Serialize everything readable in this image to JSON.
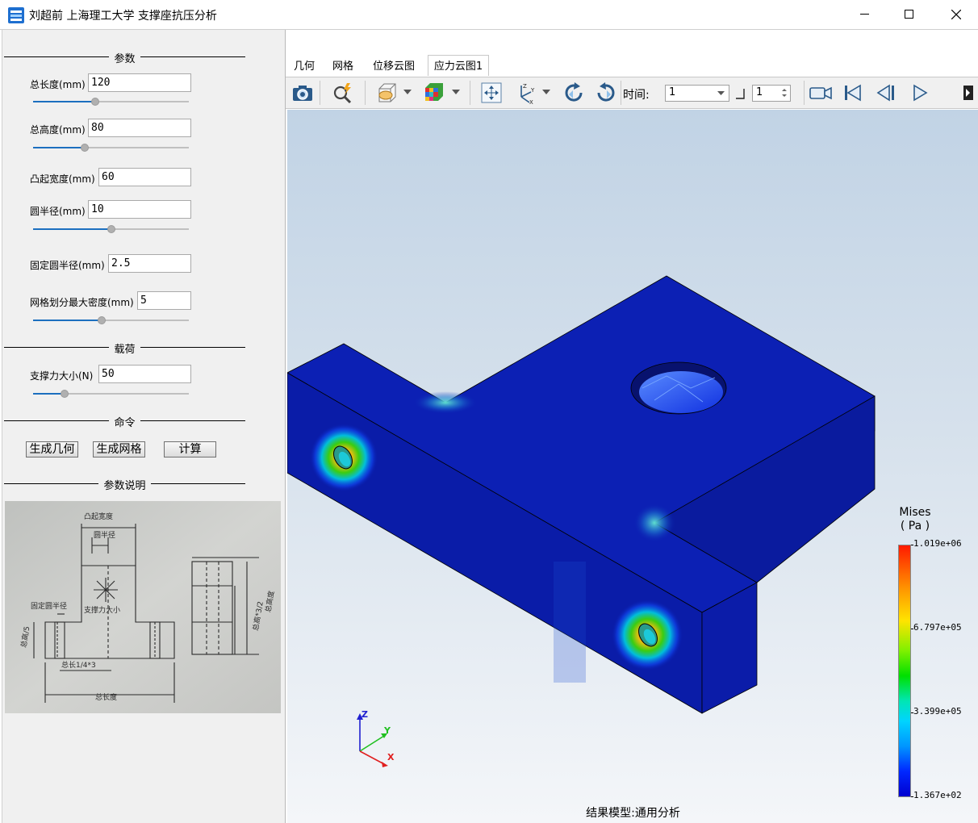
{
  "window": {
    "title": "刘超前 上海理工大学 支撑座抗压分析",
    "minimize": "—",
    "maximize": "☐",
    "close": "✕"
  },
  "params": {
    "section_title": "参数",
    "fields": [
      {
        "label": "总长度(mm)",
        "value": "120",
        "slider": 0.4
      },
      {
        "label": "总高度(mm)",
        "value": "80",
        "slider": 0.33
      },
      {
        "label": "凸起宽度(mm)",
        "value": "60"
      },
      {
        "label": "圆半径(mm)",
        "value": "10",
        "slider": 0.5
      },
      {
        "label": "固定圆半径(mm)",
        "value": "2.5"
      },
      {
        "label": "网格划分最大密度(mm)",
        "value": "5",
        "slider": 0.44
      }
    ]
  },
  "load": {
    "section_title": "载荷",
    "label": "支撑力大小(N)",
    "value": "50",
    "slider": 0.2
  },
  "commands": {
    "section_title": "命令",
    "buttons": [
      "生成几何",
      "生成网格",
      "计算"
    ]
  },
  "description": {
    "section_title": "参数说明"
  },
  "tabs": [
    "几何",
    "网格",
    "位移云图1",
    "应力云图1"
  ],
  "active_tab": "应力云图1",
  "toolbar": {
    "icons": [
      "camera-icon",
      "zoom-icon",
      "view-mode-icon",
      "color-map-icon",
      "fit-view-icon",
      "axes-icon",
      "rotate-cw-icon",
      "rotate-ccw-icon",
      "record-icon",
      "first-frame-icon",
      "prev-frame-icon",
      "play-icon",
      "more-icon"
    ],
    "time_label": "时间:",
    "time_value": "1",
    "step_value": "1"
  },
  "legend": {
    "title_line1": "Mises",
    "title_line2": "( Pa )",
    "max": "1.019e+06",
    "v2": "6.797e+05",
    "v3": "3.399e+05",
    "min": "1.367e+02"
  },
  "viewport": {
    "model_label": "结果模型:通用分析",
    "axes": [
      "Z",
      "Y",
      "X"
    ]
  }
}
